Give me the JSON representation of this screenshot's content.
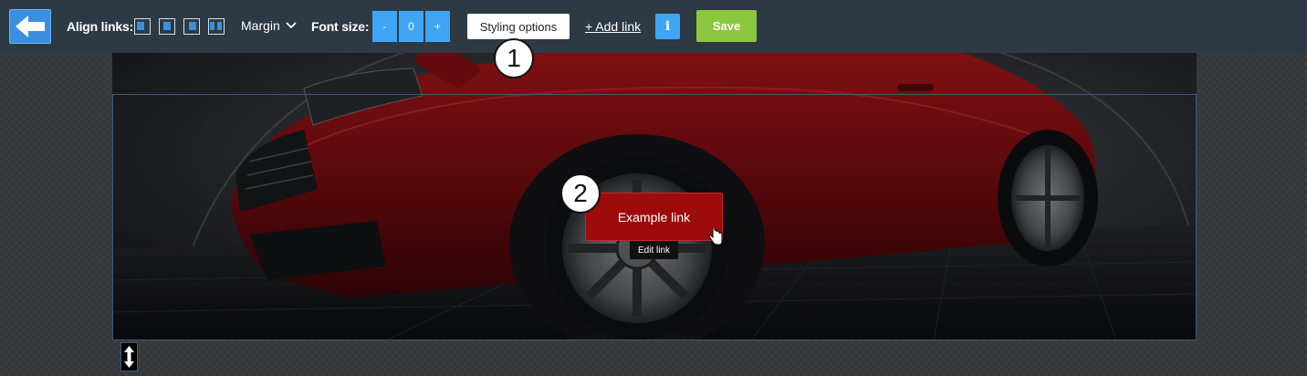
{
  "toolbar": {
    "align_label": "Align links:",
    "align_options": [
      "align-left",
      "align-center",
      "align-right",
      "align-justify"
    ],
    "margin_label": "Margin",
    "font_size_label": "Font size:",
    "font_size_minus": "-",
    "font_size_value": "0",
    "font_size_plus": "+",
    "styling_options_label": "Styling options",
    "add_link_label": "+ Add link",
    "info_label": "i",
    "save_label": "Save"
  },
  "canvas": {
    "link_label": "Example link",
    "edit_tooltip": "Edit link"
  },
  "callouts": [
    "1",
    "2"
  ],
  "colors": {
    "toolbar_bg": "#2d3a44",
    "accent_blue": "#41a5f5",
    "save_green": "#8dc63f",
    "link_red": "#9d0b0b"
  }
}
